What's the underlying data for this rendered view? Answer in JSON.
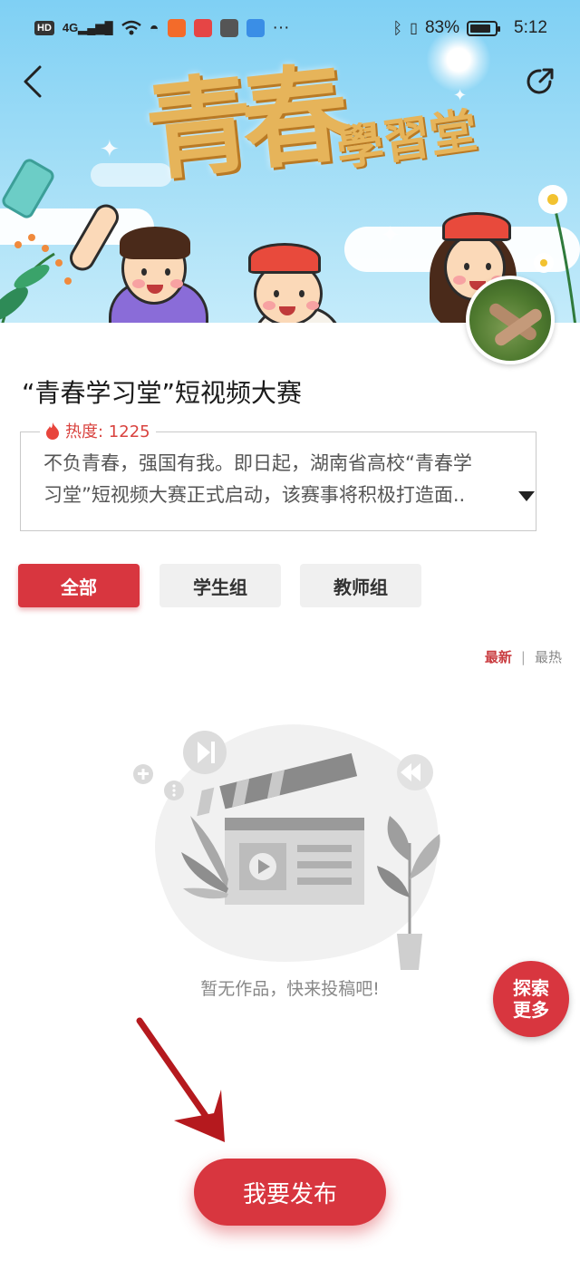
{
  "status_bar": {
    "hd_label": "HD",
    "network_label": "4G",
    "battery_percent": "83%",
    "battery_level": 0.83,
    "time": "5:12"
  },
  "banner": {
    "title_main": "青春",
    "title_sub": "學習堂"
  },
  "contest": {
    "title": "“青春学习堂”短视频大赛",
    "heat_label": "热度: 1225",
    "description_lines": [
      "不负青春，强国有我。即日起，湖南省高校“青春学",
      "习堂”短视频大赛正式启动，该赛事将积极打造面.."
    ]
  },
  "tabs": [
    {
      "label": "全部",
      "active": true
    },
    {
      "label": "学生组",
      "active": false
    },
    {
      "label": "教师组",
      "active": false
    }
  ],
  "sort": {
    "newest": "最新",
    "separator": "|",
    "hottest": "最热"
  },
  "empty": {
    "message": "暂无作品，快来投稿吧!"
  },
  "explore_button": {
    "line1": "探索",
    "line2": "更多"
  },
  "publish_button": {
    "label": "我要发布"
  },
  "colors": {
    "accent": "#d8363f",
    "heat": "#d9433f",
    "banner_sky": "#9edcf6",
    "arrow": "#b5191e"
  },
  "icons": [
    "back-icon",
    "share-icon",
    "flame-icon",
    "expand-icon",
    "play-icon",
    "clapperboard-icon",
    "plant-icon",
    "leaf-icon"
  ]
}
